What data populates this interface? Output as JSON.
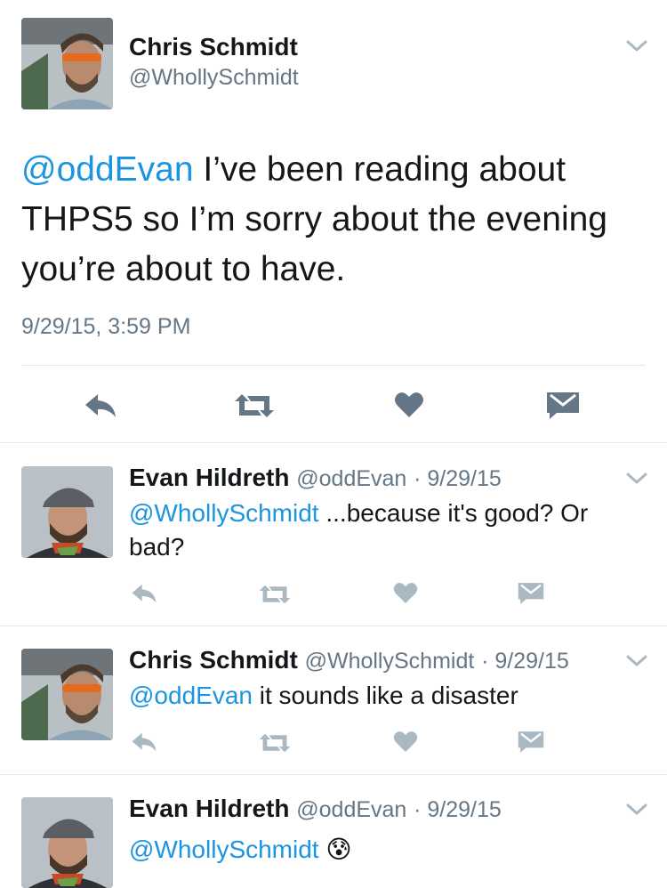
{
  "main_tweet": {
    "author_name": "Chris Schmidt",
    "author_handle": "@WhollySchmidt",
    "mention": "@oddEvan",
    "text": " I’ve been reading about THPS5 so I’m sorry about the evening you’re about to have.",
    "timestamp": "9/29/15, 3:59 PM"
  },
  "replies": [
    {
      "author_name": "Evan Hildreth",
      "author_handle": "@oddEvan",
      "date": "· 9/29/15",
      "mention": "@WhollySchmidt",
      "text": " ...because it's good? Or bad?"
    },
    {
      "author_name": "Chris Schmidt",
      "author_handle": "@WhollySchmidt",
      "date": "· 9/29/15",
      "mention": "@oddEvan",
      "text": " it sounds like a disaster"
    },
    {
      "author_name": "Evan Hildreth",
      "author_handle": "@oddEvan",
      "date": "· 9/29/15",
      "mention": "@WhollySchmidt",
      "text": " 😰"
    }
  ],
  "colors": {
    "link": "#1b95e0",
    "muted": "#657786",
    "icon_light": "#aab8c2",
    "divider": "#e1e8ed"
  },
  "icons": [
    "reply-icon",
    "retweet-icon",
    "like-icon",
    "direct-message-icon",
    "chevron-down-icon"
  ]
}
